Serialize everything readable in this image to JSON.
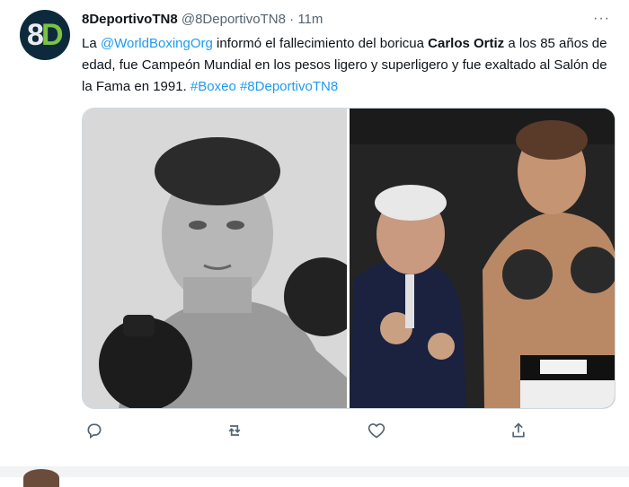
{
  "tweet": {
    "display_name": "8DeportivoTN8",
    "handle": "@8DeportivoTN8",
    "separator": "·",
    "time": "11m",
    "more_label": "···",
    "text": {
      "part1": "La ",
      "mention": "@WorldBoxingOrg",
      "part2": " informó el fallecimiento del boricua ",
      "bold_name": "Carlos Ortiz",
      "part3": " a los 85 años de edad, fue Campeón Mundial en los pesos ligero y superligero y fue exaltado al Salón de la Fama en 1991. ",
      "hashtag1": "#Boxeo",
      "space": " ",
      "hashtag2": "#8DeportivoTN8"
    },
    "avatar": {
      "glyph_8": "8",
      "glyph_d": "D",
      "bg_color": "#0d2a3d",
      "accent_color": "#7cc243"
    },
    "icons": [
      "reply-icon",
      "retweet-icon",
      "like-icon",
      "share-icon"
    ]
  }
}
